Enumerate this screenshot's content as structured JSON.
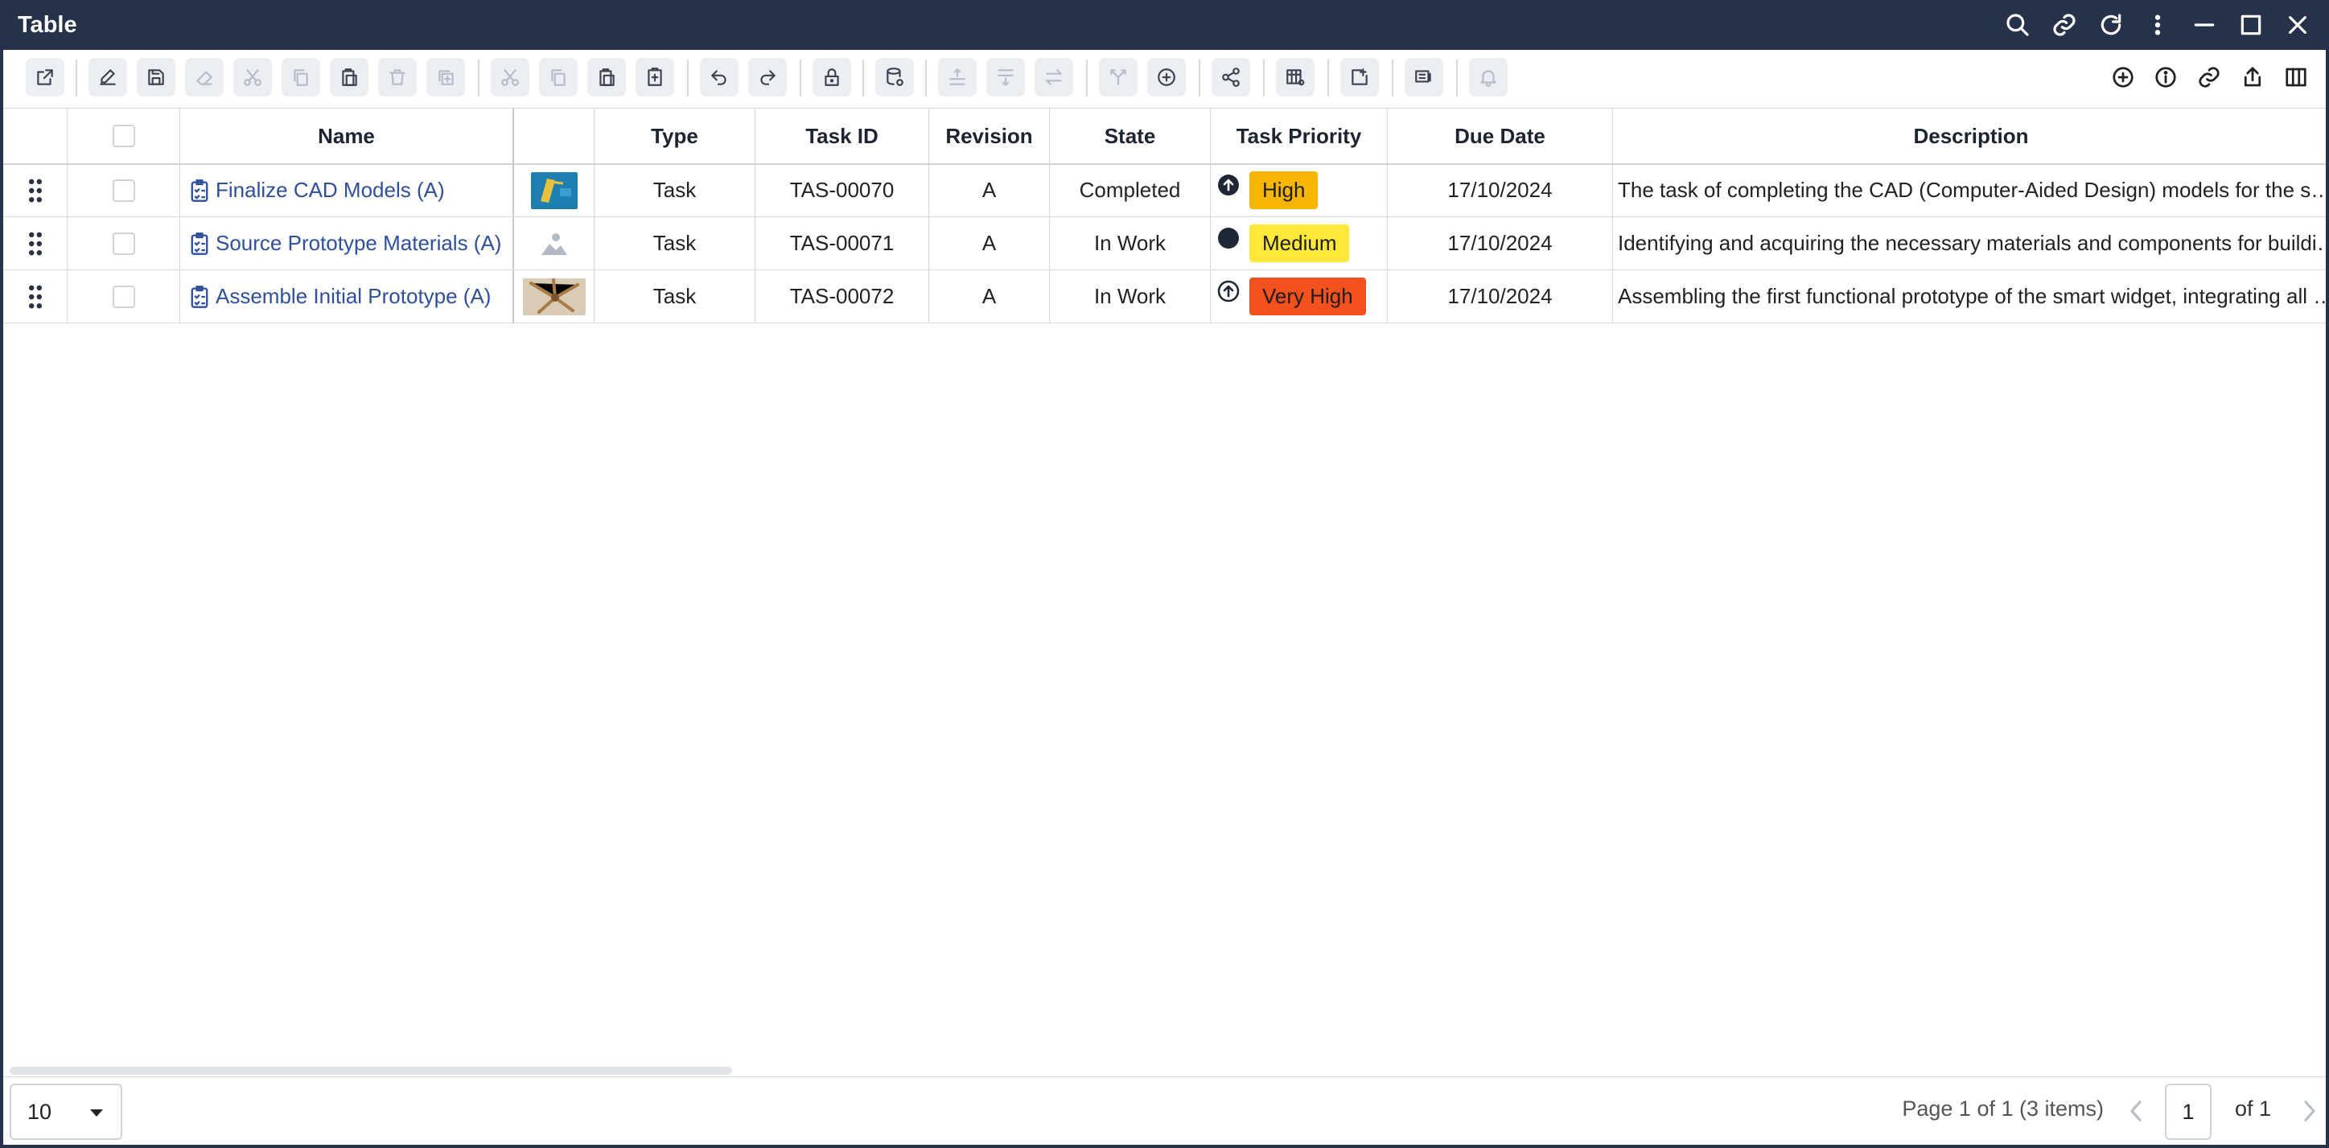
{
  "window": {
    "title": "Table"
  },
  "titlebar_icons": [
    "search-icon",
    "link-icon",
    "refresh-icon",
    "more-vertical-icon",
    "minimize-icon",
    "maximize-icon",
    "close-icon"
  ],
  "columns": {
    "name": "Name",
    "type": "Type",
    "task_id": "Task ID",
    "revision": "Revision",
    "state": "State",
    "priority": "Task Priority",
    "due_date": "Due Date",
    "description": "Description"
  },
  "rows": [
    {
      "name": "Finalize CAD Models (A)",
      "type": "Task",
      "task_id": "TAS-00070",
      "revision": "A",
      "state": "Completed",
      "priority": "High",
      "priority_color": "#f7b500",
      "priority_icon": "arrow-up-circle-icon",
      "due_date": "17/10/2024",
      "description": "The task of completing the CAD (Computer-Aided Design) models for the s…",
      "thumbnail": "cad-drawing-thumbnail"
    },
    {
      "name": "Source Prototype Materials (A)",
      "type": "Task",
      "task_id": "TAS-00071",
      "revision": "A",
      "state": "In Work",
      "priority": "Medium",
      "priority_color": "#ffe83a",
      "priority_icon": "dot-icon",
      "due_date": "17/10/2024",
      "description": "Identifying and acquiring the necessary materials and components for buildi…",
      "thumbnail": "placeholder-image"
    },
    {
      "name": "Assemble Initial Prototype (A)",
      "type": "Task",
      "task_id": "TAS-00072",
      "revision": "A",
      "state": "In Work",
      "priority": "Very High",
      "priority_color": "#f4511e",
      "priority_icon": "arrow-up-circle-outline-icon",
      "due_date": "17/10/2024",
      "description": "Assembling the first functional prototype of the smart widget, integrating all …",
      "thumbnail": "prototype-photo-thumbnail"
    }
  ],
  "footer": {
    "page_size": "10",
    "page_info": "Page 1 of 1 (3 items)",
    "current_page": "1",
    "of_label": "of 1"
  }
}
